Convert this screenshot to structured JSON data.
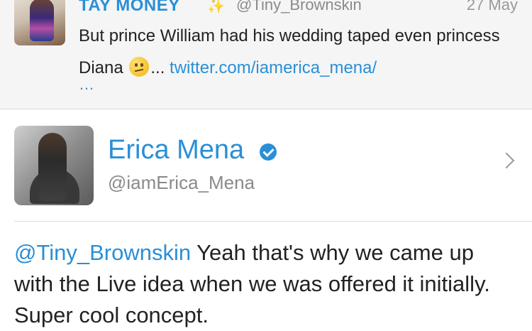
{
  "reply": {
    "name": "TAY MONEY",
    "sparkle_icon": "sparkles-icon",
    "handle": "@Tiny_Brownskin",
    "date": "27 May",
    "text_before": "But prince William had his wedding taped even princess Diana ",
    "emoji_icon": "confused-face-icon",
    "text_ellipsis": "... ",
    "link": "twitter.com/iamerica_mena/",
    "more": "…"
  },
  "profile": {
    "name": "Erica Mena",
    "verified_icon": "verified-badge-icon",
    "handle": "@iamErica_Mena",
    "chevron_icon": "chevron-right-icon"
  },
  "tweet": {
    "mention": "@Tiny_Brownskin",
    "text": " Yeah that's why we came up with the Live idea when we was offered it initially. Super cool concept."
  },
  "colors": {
    "accent": "#2a8fd6",
    "muted": "#8a8a8a",
    "reply_bg": "#f5f5f5"
  }
}
